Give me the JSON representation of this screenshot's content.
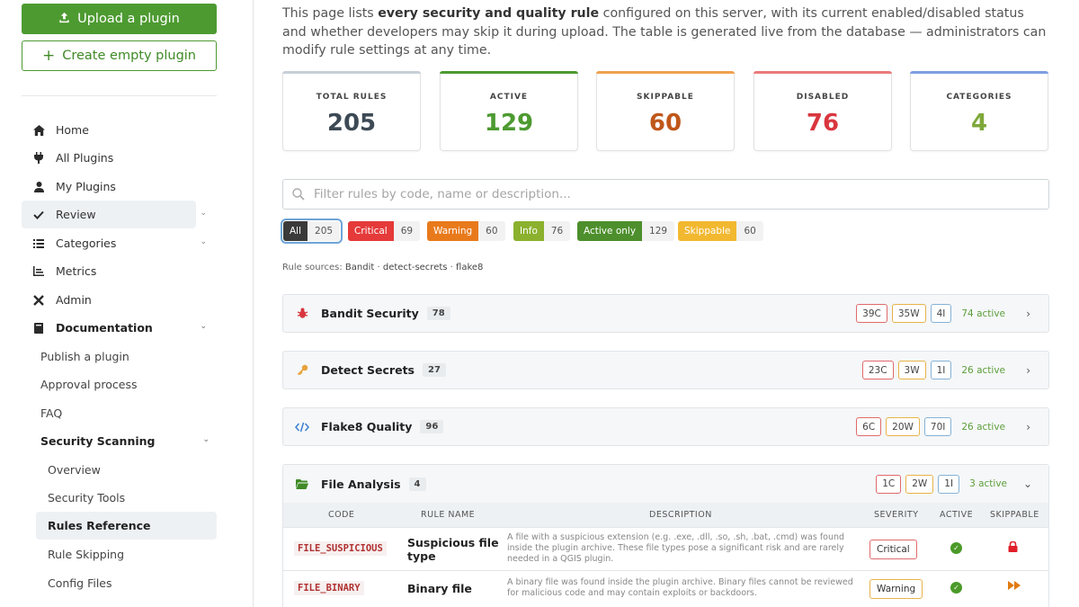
{
  "sidebar": {
    "upload_label": "Upload a plugin",
    "create_label": "Create empty plugin",
    "nav": [
      {
        "label": "Home",
        "icon": "home-icon"
      },
      {
        "label": "All Plugins",
        "icon": "plug-icon"
      },
      {
        "label": "My Plugins",
        "icon": "user-icon"
      },
      {
        "label": "Review",
        "icon": "check-icon"
      },
      {
        "label": "Categories",
        "icon": "list-icon"
      },
      {
        "label": "Metrics",
        "icon": "chart-icon"
      },
      {
        "label": "Admin",
        "icon": "tools-icon"
      },
      {
        "label": "Documentation",
        "icon": "book-icon"
      }
    ],
    "doc_items": [
      "Publish a plugin",
      "Approval process",
      "FAQ",
      "Security Scanning"
    ],
    "security_items": [
      "Overview",
      "Security Tools",
      "Rules Reference",
      "Rule Skipping",
      "Config Files"
    ]
  },
  "intro": {
    "part1": "This page lists ",
    "bold": "every security and quality rule",
    "part2": " configured on this server, with its current enabled/disabled status and whether developers may skip it during upload. The table is generated live from the database — administrators can modify rule settings at any time."
  },
  "stats": [
    {
      "label": "TOTAL RULES",
      "value": "205",
      "color": "#3d4a55",
      "bar": "#c7cfd8"
    },
    {
      "label": "ACTIVE",
      "value": "129",
      "color": "#4d9a31",
      "bar": "#4d9a31"
    },
    {
      "label": "SKIPPABLE",
      "value": "60",
      "color": "#c0571a",
      "bar": "#f0a050"
    },
    {
      "label": "DISABLED",
      "value": "76",
      "color": "#d9363e",
      "bar": "#ea7a7a"
    },
    {
      "label": "CATEGORIES",
      "value": "4",
      "color": "#7fa83a",
      "bar": "#7e9ee0"
    }
  ],
  "search": {
    "placeholder": "Filter rules by code, name or description..."
  },
  "chips": [
    {
      "label": "All",
      "count": "205",
      "color": "#3a3a3a"
    },
    {
      "label": "Critical",
      "count": "69",
      "color": "#e53a3a"
    },
    {
      "label": "Warning",
      "count": "60",
      "color": "#e87a1c"
    },
    {
      "label": "Info",
      "count": "76",
      "color": "#8bb12e"
    },
    {
      "label": "Active only",
      "count": "129",
      "color": "#4d8f2c"
    },
    {
      "label": "Skippable",
      "count": "60",
      "color": "#f2b830"
    }
  ],
  "sources": {
    "label": "Rule sources: ",
    "items": [
      "Bandit",
      "detect-secrets",
      "flake8"
    ]
  },
  "groups": [
    {
      "name": "Bandit Security",
      "count": "78",
      "c": "39C",
      "w": "35W",
      "i": "4I",
      "active": "74 active",
      "icon": "bug-icon"
    },
    {
      "name": "Detect Secrets",
      "count": "27",
      "c": "23C",
      "w": "3W",
      "i": "1I",
      "active": "26 active",
      "icon": "key-icon"
    },
    {
      "name": "Flake8 Quality",
      "count": "96",
      "c": "6C",
      "w": "20W",
      "i": "70I",
      "active": "26 active",
      "icon": "code-icon"
    },
    {
      "name": "File Analysis",
      "count": "4",
      "c": "1C",
      "w": "2W",
      "i": "1I",
      "active": "3 active",
      "icon": "folder-icon"
    }
  ],
  "table": {
    "headers": [
      "CODE",
      "RULE NAME",
      "DESCRIPTION",
      "SEVERITY",
      "ACTIVE",
      "SKIPPABLE"
    ],
    "rows": [
      {
        "code": "FILE_SUSPICIOUS",
        "name": "Suspicious file type",
        "desc": "A file with a suspicious extension (e.g. .exe, .dll, .so, .sh, .bat, .cmd) was found inside the plugin archive. These file types pose a significant risk and are rarely needed in a QGIS plugin.",
        "severity": "Critical"
      },
      {
        "code": "FILE_BINARY",
        "name": "Binary file",
        "desc": "A binary file was found inside the plugin archive. Binary files cannot be reviewed for malicious code and may contain exploits or backdoors.",
        "severity": "Warning"
      }
    ]
  }
}
